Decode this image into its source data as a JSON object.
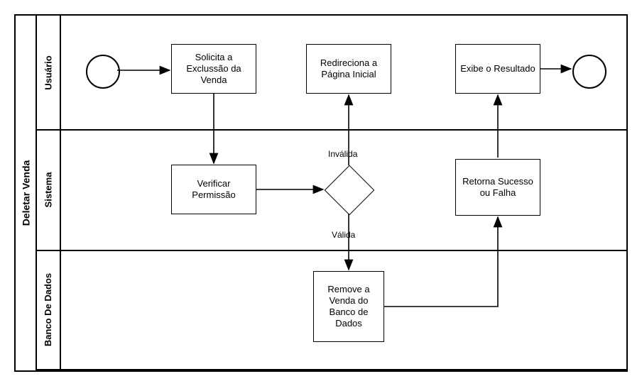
{
  "pool_label": "Deletar Venda",
  "lanes": {
    "usuario": {
      "label": "Usuário"
    },
    "sistema": {
      "label": "Sistema"
    },
    "banco": {
      "label": "Banco De Dados"
    }
  },
  "tasks": {
    "solicita": {
      "label": "Solicita a Exclussão da Venda"
    },
    "redireciona": {
      "label": "Redireciona a Página Inicial"
    },
    "exibe": {
      "label": "Exibe o Resultado"
    },
    "verificar": {
      "label": "Verificar Permissão"
    },
    "retorna": {
      "label": "Retorna Sucesso ou Falha"
    },
    "remove": {
      "label": "Remove a Venda do Banco de Dados"
    }
  },
  "gateway_labels": {
    "invalida": "Inválida",
    "valida": "Válida"
  }
}
